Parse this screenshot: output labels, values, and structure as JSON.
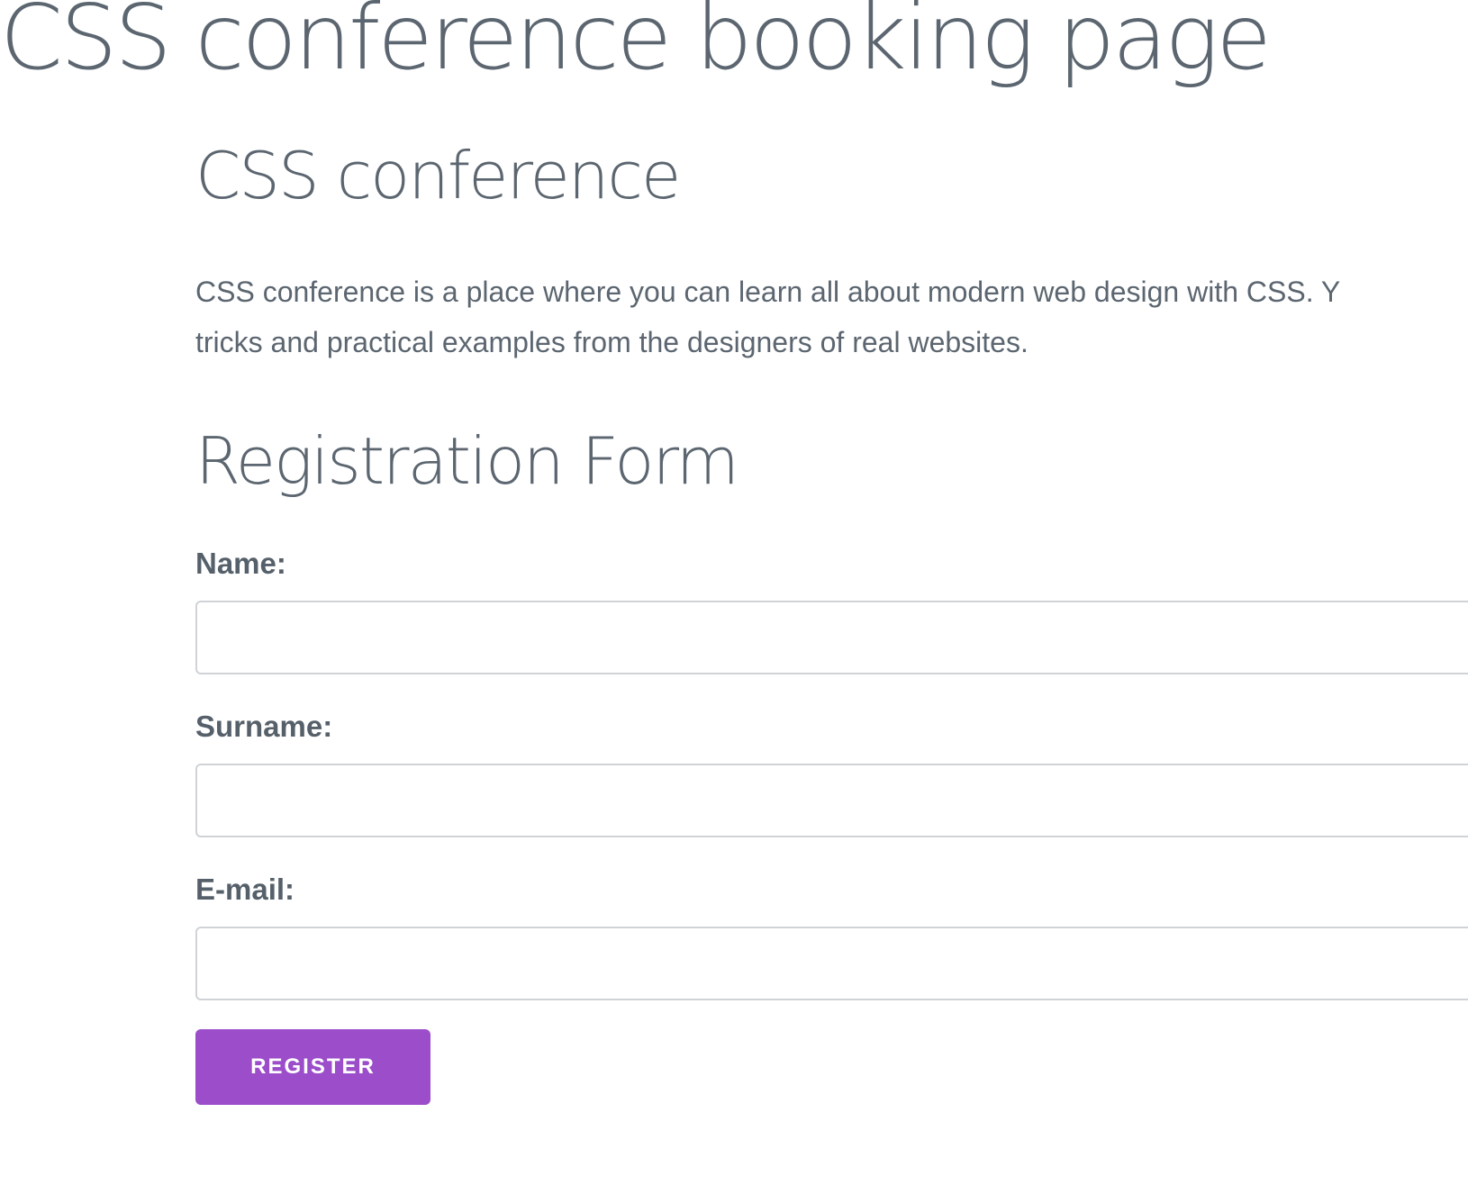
{
  "page": {
    "title": "CSS conference booking page"
  },
  "conference": {
    "title": "CSS conference",
    "description_line1": "CSS conference is a place where you can learn all about modern web design with CSS. Y",
    "description_line2": "tricks and practical examples from the designers of real websites."
  },
  "form": {
    "title": "Registration Form",
    "fields": [
      {
        "label": "Name:",
        "value": "",
        "placeholder": ""
      },
      {
        "label": "Surname:",
        "value": "",
        "placeholder": ""
      },
      {
        "label": "E-mail:",
        "value": "",
        "placeholder": ""
      }
    ],
    "submit_label": "REGISTER"
  },
  "colors": {
    "text": "#5c6670",
    "button_background": "#9b4dca",
    "button_text": "#ffffff",
    "input_border": "#cfd3d7"
  }
}
